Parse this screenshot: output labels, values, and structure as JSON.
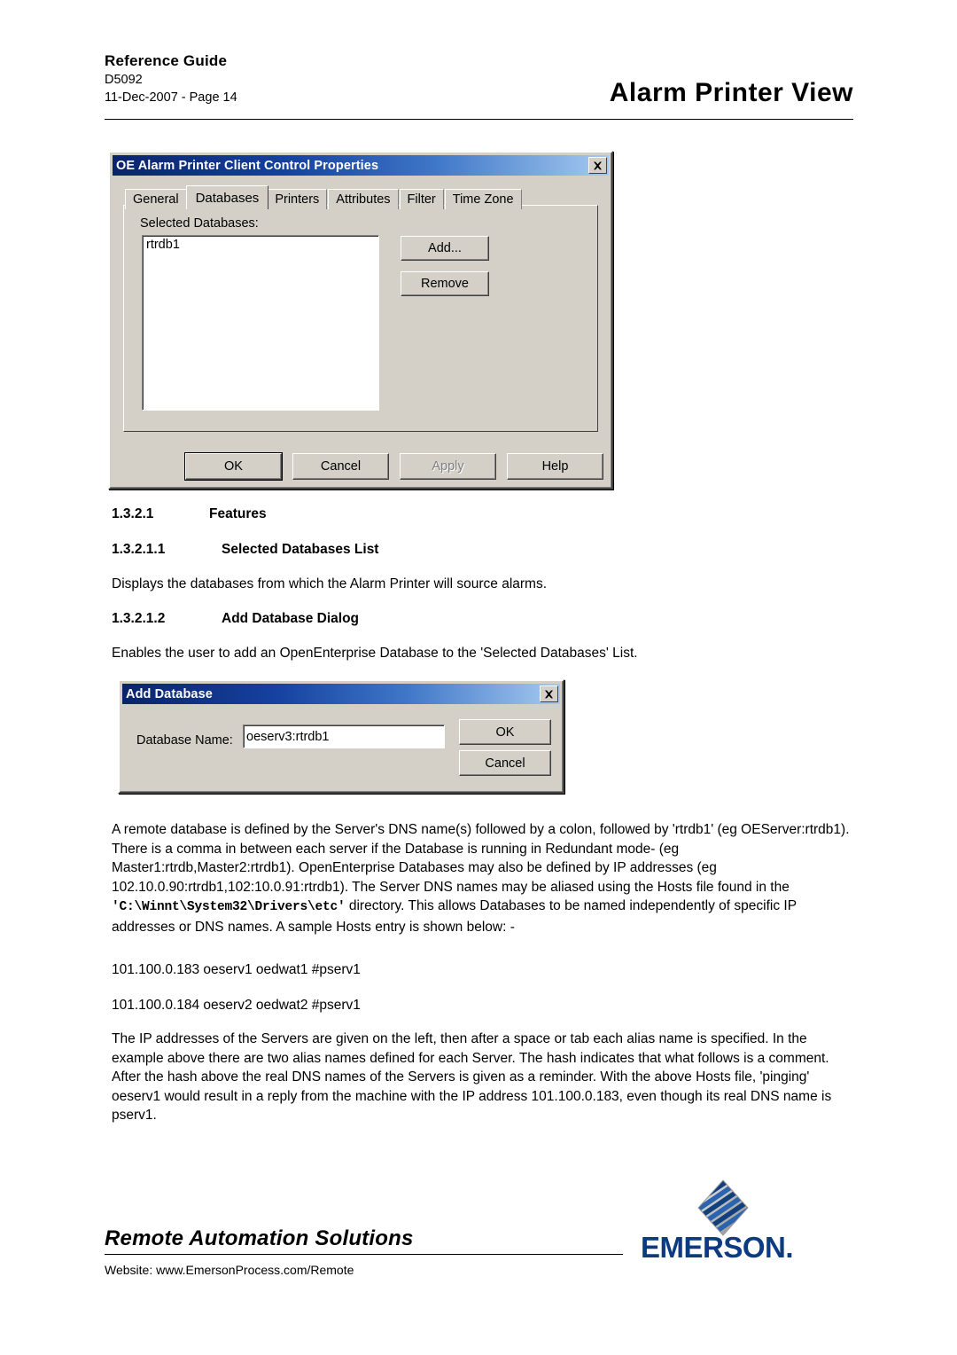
{
  "header": {
    "guide_title": "Reference Guide",
    "doc_number": "D5092",
    "date_page": "11-Dec-2007 - Page 14",
    "page_title": "Alarm Printer View"
  },
  "properties_dialog": {
    "title": "OE Alarm Printer Client Control Properties",
    "close_icon": "close-icon",
    "tabs": [
      {
        "label": "General",
        "active": false
      },
      {
        "label": "Databases",
        "active": true
      },
      {
        "label": "Printers",
        "active": false
      },
      {
        "label": "Attributes",
        "active": false
      },
      {
        "label": "Filter",
        "active": false
      },
      {
        "label": "Time Zone",
        "active": false
      }
    ],
    "group_label": "Selected Databases:",
    "list_items": [
      "rtrdb1"
    ],
    "side_buttons": [
      {
        "label": "Add...",
        "enabled": true
      },
      {
        "label": "Remove",
        "enabled": true
      }
    ],
    "footer_buttons": [
      {
        "label": "OK",
        "enabled": true,
        "default": true
      },
      {
        "label": "Cancel",
        "enabled": true,
        "default": false
      },
      {
        "label": "Apply",
        "enabled": false,
        "default": false
      },
      {
        "label": "Help",
        "enabled": true,
        "default": false
      }
    ]
  },
  "sections": {
    "features": {
      "number": "1.3.2.1",
      "label": "Features"
    },
    "selected_databases_list": {
      "number": "1.3.2.1.1",
      "label": "Selected Databases List"
    },
    "selected_databases_body": "Displays the databases from which the Alarm Printer will source alarms.",
    "add_database_dialog": {
      "number": "1.3.2.1.2",
      "label": "Add Database Dialog"
    },
    "add_database_body": "Enables the user to add an OpenEnterprise Database to the 'Selected Databases' List."
  },
  "add_database_dialog": {
    "title": "Add Database",
    "close_icon": "close-icon",
    "field_label": "Database Name:",
    "field_value": "oeserv3:rtrdb1",
    "buttons": [
      {
        "label": "OK"
      },
      {
        "label": "Cancel"
      }
    ]
  },
  "remote_db_paragraph": {
    "part1": "A remote database is defined by the Server's DNS name(s) followed by a colon, followed by 'rtrdb1' (eg OEServer:rtrdb1). There is a comma in between each server if the Database is running in Redundant mode- (eg Master1:rtrdb,Master2:rtrdb1). OpenEnterprise Databases may also be defined by IP addresses (eg 102.10.0.90:rtrdb1,102:10.0.91:rtrdb1). The Server DNS names may be aliased using the Hosts file found in the ",
    "path": "'C:\\Winnt\\System32\\Drivers\\etc'",
    "part2": " directory. This allows Databases to be named independently of specific IP addresses or DNS names. A sample Hosts entry is shown below: -"
  },
  "hosts_entries": [
    "101.100.0.183 oeserv1 oedwat1 #pserv1",
    "101.100.0.184 oeserv2 oedwat2 #pserv1"
  ],
  "ip_explanation": "The IP addresses of the Servers are given on the left, then after a space or tab each alias name is specified. In the example above there are two alias names defined for each Server. The hash indicates that what follows is a comment. After the hash above the real DNS names of the Servers is given as a reminder. With the above Hosts file, 'pinging' oeserv1 would result in a reply from the machine with the IP address 101.100.0.183, even though its real DNS name is pserv1.",
  "footer": {
    "tagline": "Remote Automation Solutions",
    "website": "Website:  www.EmersonProcess.com/Remote",
    "brand": "EMERSON",
    "brand_dot": ".",
    "brand_color": "#0d3b81",
    "logo_icon": "emerson-diamond-logo"
  }
}
